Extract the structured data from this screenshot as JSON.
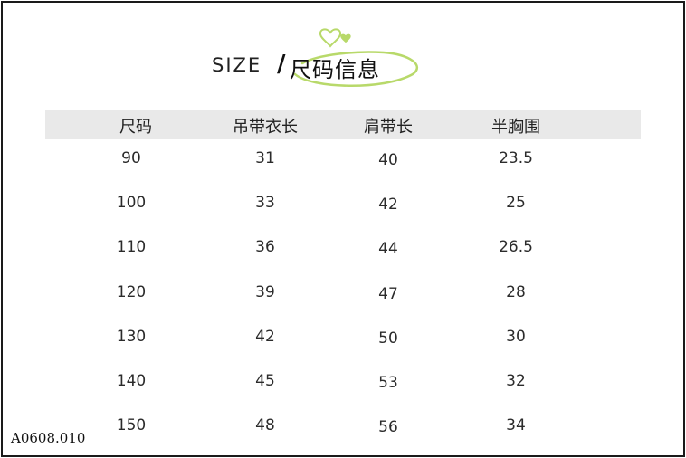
{
  "title": {
    "latin": "SIZE",
    "slash": "/",
    "chinese": "尺码信息"
  },
  "table": {
    "headers": [
      "尺码",
      "吊带衣长",
      "肩带长",
      "半胸围"
    ],
    "rows": [
      [
        "90",
        "31",
        "40",
        "23.5"
      ],
      [
        "100",
        "33",
        "42",
        "25"
      ],
      [
        "110",
        "36",
        "44",
        "26.5"
      ],
      [
        "120",
        "39",
        "47",
        "28"
      ],
      [
        "130",
        "42",
        "50",
        "30"
      ],
      [
        "140",
        "45",
        "53",
        "32"
      ],
      [
        "150",
        "48",
        "56",
        "34"
      ]
    ]
  },
  "product_code": "A0608.010",
  "colors": {
    "accent": "#b8d96a",
    "header_bg": "#e9e9e9",
    "border": "#1a1a1a"
  },
  "icons": [
    "heart-icon",
    "heart-icon"
  ]
}
